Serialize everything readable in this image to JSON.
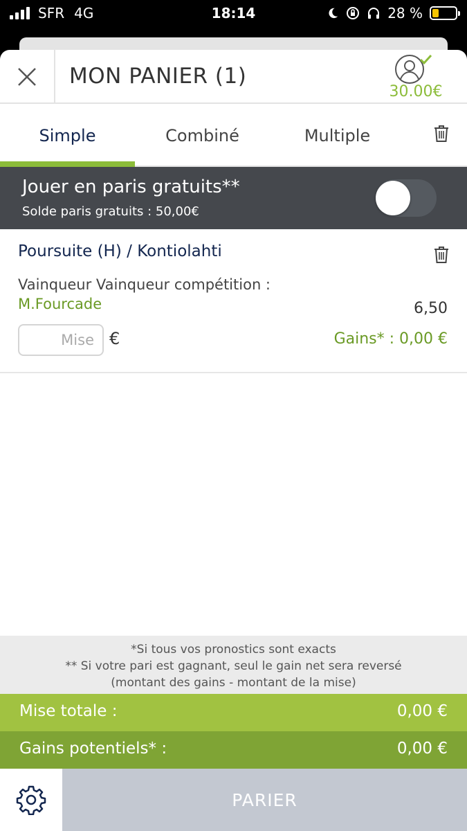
{
  "status_bar": {
    "carrier": "SFR",
    "network": "4G",
    "time": "18:14",
    "battery_percent": "28 %"
  },
  "header": {
    "title": "MON PANIER (1)",
    "balance": "30.00€"
  },
  "tabs": [
    {
      "label": "Simple",
      "active": true
    },
    {
      "label": "Combiné",
      "active": false
    },
    {
      "label": "Multiple",
      "active": false
    }
  ],
  "freebet": {
    "title": "Jouer en paris gratuits**",
    "balance_text": "Solde paris gratuits : 50,00€",
    "enabled": false
  },
  "bet": {
    "event": "Poursuite (H) / Kontiolahti",
    "market": "Vainqueur Vainqueur compétition : ",
    "selection": "M.Fourcade",
    "odds": "6,50",
    "stake_placeholder": "Mise",
    "currency": "€",
    "gains": "Gains* : 0,00 €"
  },
  "notes": {
    "line1": "*Si tous vos pronostics sont exacts",
    "line2": "** Si votre pari est gagnant, seul le gain net sera reversé",
    "line3": "(montant des gains - montant de la mise)"
  },
  "totals": {
    "stake_label": "Mise totale  :",
    "stake_value": "0,00 €",
    "gains_label": "Gains potentiels* :",
    "gains_value": "0,00 €"
  },
  "footer": {
    "bet_button": "PARIER"
  },
  "colors": {
    "accent_green": "#8cbc3a",
    "navy": "#13264f",
    "dark_bar": "#45484d",
    "stake_row": "#a1c241",
    "gains_row": "#7fa435",
    "disabled_button": "#c3c8d1"
  },
  "icons": {
    "close": "close-icon",
    "account": "user-check-icon",
    "trash": "trash-icon",
    "settings": "gear-icon"
  }
}
